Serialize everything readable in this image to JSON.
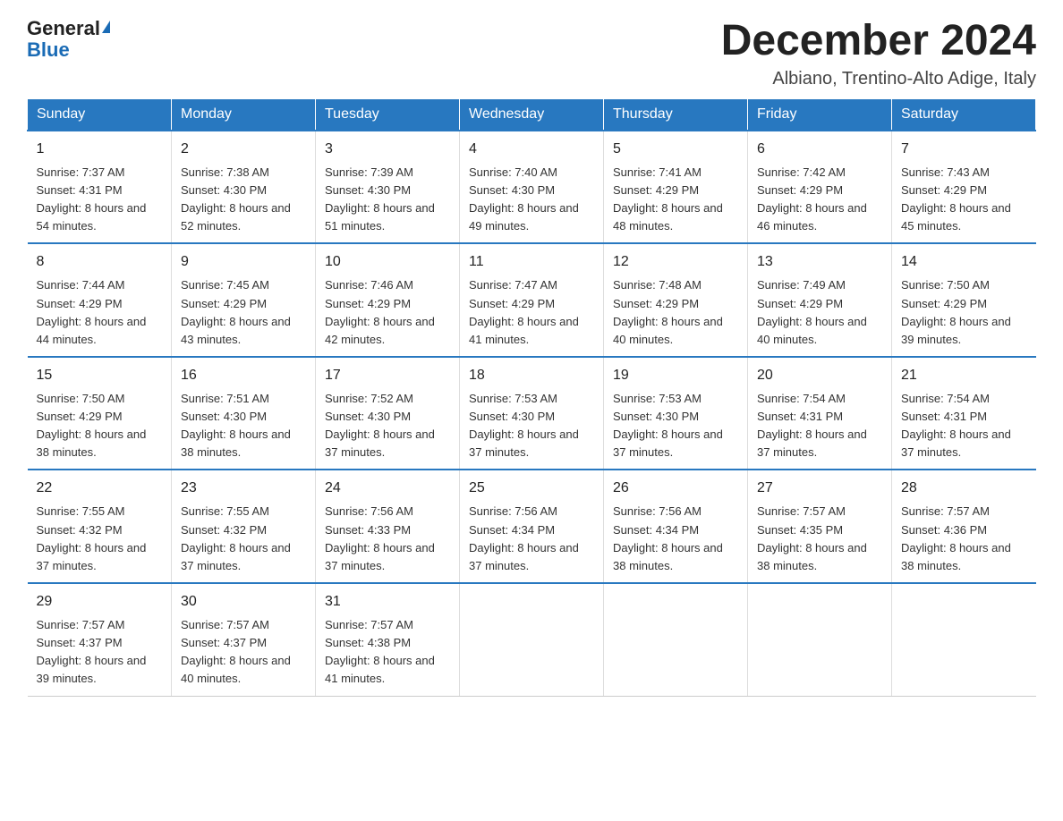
{
  "logo": {
    "general": "General",
    "triangle": "▶",
    "blue": "Blue"
  },
  "title": {
    "month_year": "December 2024",
    "location": "Albiano, Trentino-Alto Adige, Italy"
  },
  "headers": [
    "Sunday",
    "Monday",
    "Tuesday",
    "Wednesday",
    "Thursday",
    "Friday",
    "Saturday"
  ],
  "weeks": [
    [
      {
        "day": "1",
        "sunrise": "7:37 AM",
        "sunset": "4:31 PM",
        "daylight": "8 hours and 54 minutes."
      },
      {
        "day": "2",
        "sunrise": "7:38 AM",
        "sunset": "4:30 PM",
        "daylight": "8 hours and 52 minutes."
      },
      {
        "day": "3",
        "sunrise": "7:39 AM",
        "sunset": "4:30 PM",
        "daylight": "8 hours and 51 minutes."
      },
      {
        "day": "4",
        "sunrise": "7:40 AM",
        "sunset": "4:30 PM",
        "daylight": "8 hours and 49 minutes."
      },
      {
        "day": "5",
        "sunrise": "7:41 AM",
        "sunset": "4:29 PM",
        "daylight": "8 hours and 48 minutes."
      },
      {
        "day": "6",
        "sunrise": "7:42 AM",
        "sunset": "4:29 PM",
        "daylight": "8 hours and 46 minutes."
      },
      {
        "day": "7",
        "sunrise": "7:43 AM",
        "sunset": "4:29 PM",
        "daylight": "8 hours and 45 minutes."
      }
    ],
    [
      {
        "day": "8",
        "sunrise": "7:44 AM",
        "sunset": "4:29 PM",
        "daylight": "8 hours and 44 minutes."
      },
      {
        "day": "9",
        "sunrise": "7:45 AM",
        "sunset": "4:29 PM",
        "daylight": "8 hours and 43 minutes."
      },
      {
        "day": "10",
        "sunrise": "7:46 AM",
        "sunset": "4:29 PM",
        "daylight": "8 hours and 42 minutes."
      },
      {
        "day": "11",
        "sunrise": "7:47 AM",
        "sunset": "4:29 PM",
        "daylight": "8 hours and 41 minutes."
      },
      {
        "day": "12",
        "sunrise": "7:48 AM",
        "sunset": "4:29 PM",
        "daylight": "8 hours and 40 minutes."
      },
      {
        "day": "13",
        "sunrise": "7:49 AM",
        "sunset": "4:29 PM",
        "daylight": "8 hours and 40 minutes."
      },
      {
        "day": "14",
        "sunrise": "7:50 AM",
        "sunset": "4:29 PM",
        "daylight": "8 hours and 39 minutes."
      }
    ],
    [
      {
        "day": "15",
        "sunrise": "7:50 AM",
        "sunset": "4:29 PM",
        "daylight": "8 hours and 38 minutes."
      },
      {
        "day": "16",
        "sunrise": "7:51 AM",
        "sunset": "4:30 PM",
        "daylight": "8 hours and 38 minutes."
      },
      {
        "day": "17",
        "sunrise": "7:52 AM",
        "sunset": "4:30 PM",
        "daylight": "8 hours and 37 minutes."
      },
      {
        "day": "18",
        "sunrise": "7:53 AM",
        "sunset": "4:30 PM",
        "daylight": "8 hours and 37 minutes."
      },
      {
        "day": "19",
        "sunrise": "7:53 AM",
        "sunset": "4:30 PM",
        "daylight": "8 hours and 37 minutes."
      },
      {
        "day": "20",
        "sunrise": "7:54 AM",
        "sunset": "4:31 PM",
        "daylight": "8 hours and 37 minutes."
      },
      {
        "day": "21",
        "sunrise": "7:54 AM",
        "sunset": "4:31 PM",
        "daylight": "8 hours and 37 minutes."
      }
    ],
    [
      {
        "day": "22",
        "sunrise": "7:55 AM",
        "sunset": "4:32 PM",
        "daylight": "8 hours and 37 minutes."
      },
      {
        "day": "23",
        "sunrise": "7:55 AM",
        "sunset": "4:32 PM",
        "daylight": "8 hours and 37 minutes."
      },
      {
        "day": "24",
        "sunrise": "7:56 AM",
        "sunset": "4:33 PM",
        "daylight": "8 hours and 37 minutes."
      },
      {
        "day": "25",
        "sunrise": "7:56 AM",
        "sunset": "4:34 PM",
        "daylight": "8 hours and 37 minutes."
      },
      {
        "day": "26",
        "sunrise": "7:56 AM",
        "sunset": "4:34 PM",
        "daylight": "8 hours and 38 minutes."
      },
      {
        "day": "27",
        "sunrise": "7:57 AM",
        "sunset": "4:35 PM",
        "daylight": "8 hours and 38 minutes."
      },
      {
        "day": "28",
        "sunrise": "7:57 AM",
        "sunset": "4:36 PM",
        "daylight": "8 hours and 38 minutes."
      }
    ],
    [
      {
        "day": "29",
        "sunrise": "7:57 AM",
        "sunset": "4:37 PM",
        "daylight": "8 hours and 39 minutes."
      },
      {
        "day": "30",
        "sunrise": "7:57 AM",
        "sunset": "4:37 PM",
        "daylight": "8 hours and 40 minutes."
      },
      {
        "day": "31",
        "sunrise": "7:57 AM",
        "sunset": "4:38 PM",
        "daylight": "8 hours and 41 minutes."
      },
      null,
      null,
      null,
      null
    ]
  ],
  "labels": {
    "sunrise": "Sunrise: ",
    "sunset": "Sunset: ",
    "daylight": "Daylight: "
  }
}
